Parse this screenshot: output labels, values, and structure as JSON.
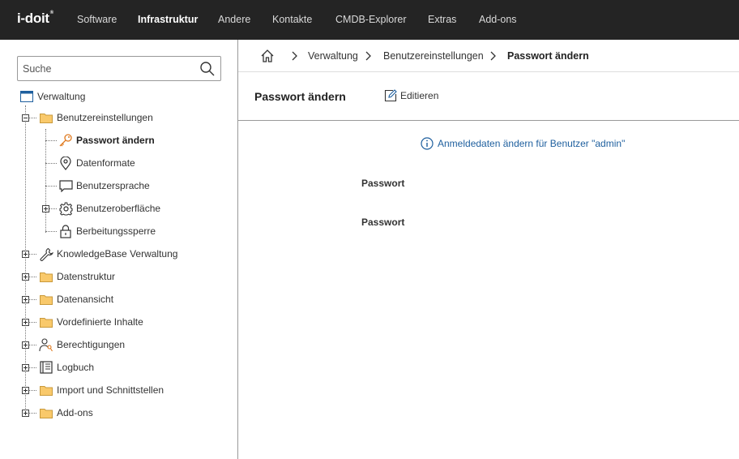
{
  "app": {
    "logo": "i-doit",
    "logo_mark": "®"
  },
  "nav": {
    "items": [
      {
        "label": "Software",
        "active": false
      },
      {
        "label": "Infrastruktur",
        "active": true
      },
      {
        "label": "Andere",
        "active": false
      },
      {
        "label": "Kontakte",
        "active": false
      },
      {
        "label": "CMDB-Explorer",
        "active": false
      },
      {
        "label": "Extras",
        "active": false
      },
      {
        "label": "Add-ons",
        "active": false
      }
    ]
  },
  "search": {
    "placeholder": "Suche",
    "value": ""
  },
  "tree": {
    "root": {
      "label": "Verwaltung",
      "icon": "window-icon"
    },
    "items": [
      {
        "label": "Benutzereinstellungen",
        "icon": "folder-icon",
        "expander": "minus"
      },
      {
        "label": "Passwort ändern",
        "icon": "key-icon",
        "selected": true
      },
      {
        "label": "Datenformate",
        "icon": "location-pin-icon"
      },
      {
        "label": "Benutzersprache",
        "icon": "speech-bubble-icon"
      },
      {
        "label": "Benutzeroberfläche",
        "icon": "gear-icon",
        "expander": "plus"
      },
      {
        "label": "Berbeitungssperre",
        "icon": "lock-icon"
      },
      {
        "label": "KnowledgeBase Verwaltung",
        "icon": "wrench-icon",
        "expander": "plus"
      },
      {
        "label": "Datenstruktur",
        "icon": "folder-icon",
        "expander": "plus"
      },
      {
        "label": "Datenansicht",
        "icon": "folder-icon",
        "expander": "plus"
      },
      {
        "label": "Vordefinierte Inhalte",
        "icon": "folder-icon",
        "expander": "plus"
      },
      {
        "label": "Berechtigungen",
        "icon": "users-key-icon",
        "expander": "plus"
      },
      {
        "label": "Logbuch",
        "icon": "logbook-icon",
        "expander": "plus"
      },
      {
        "label": "Import und Schnittstellen",
        "icon": "folder-icon",
        "expander": "plus"
      },
      {
        "label": "Add-ons",
        "icon": "folder-icon",
        "expander": "plus"
      }
    ]
  },
  "breadcrumb": {
    "home_icon": "home-icon",
    "items": [
      "Verwaltung",
      "Benutzereinstellungen",
      "Passwort ändern"
    ]
  },
  "page": {
    "title": "Passwort ändern",
    "edit_label": "Editieren",
    "info": "Anmeldedaten ändern für Benutzer \"admin\"",
    "fields": [
      "Passwort",
      "Passwort"
    ]
  },
  "colors": {
    "topbar": "#242424",
    "folder": "#f9c96b",
    "key": "#e07a1f",
    "info": "#1e5f9e"
  }
}
